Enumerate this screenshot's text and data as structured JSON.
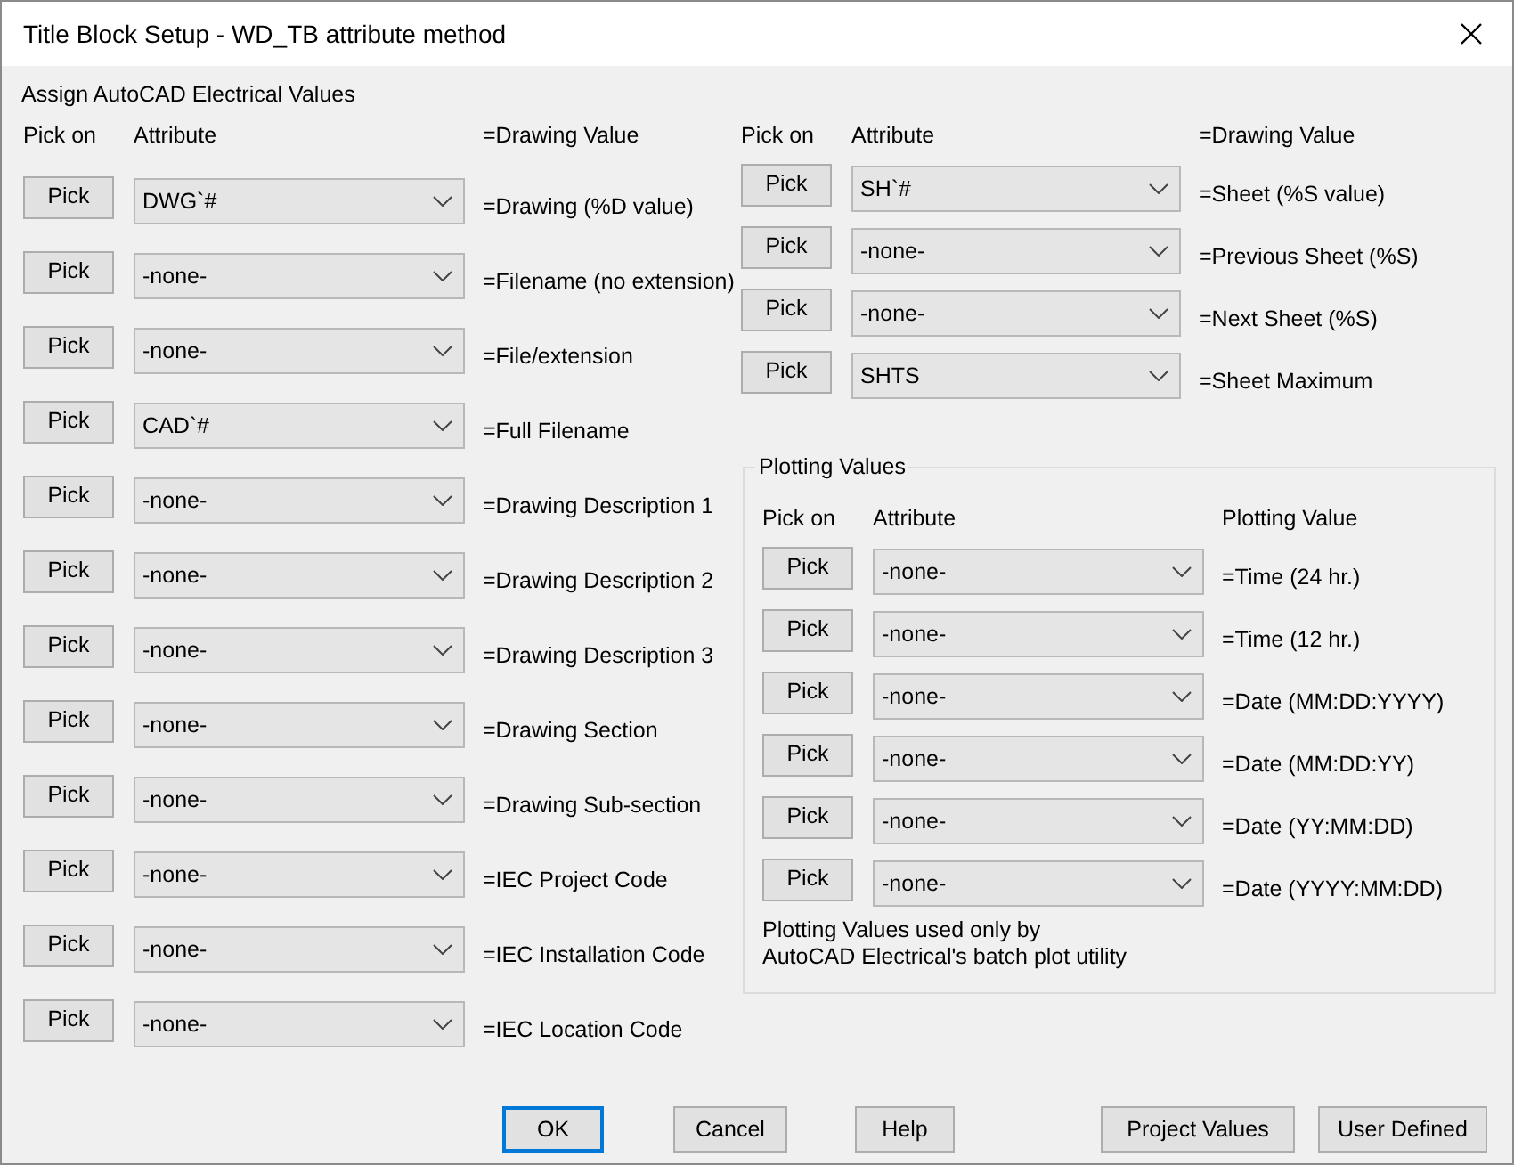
{
  "window": {
    "title": "Title Block Setup - WD_TB attribute method"
  },
  "section_label": "Assign AutoCAD Electrical Values",
  "left": {
    "headers": [
      "Pick on",
      "Attribute",
      "=Drawing Value"
    ],
    "rows": [
      {
        "button": "Pick",
        "attribute": "DWG`#",
        "label": "=Drawing (%D value)"
      },
      {
        "button": "Pick",
        "attribute": "-none-",
        "label": "=Filename (no extension)"
      },
      {
        "button": "Pick",
        "attribute": "-none-",
        "label": "=File/extension"
      },
      {
        "button": "Pick",
        "attribute": "CAD`#",
        "label": "=Full Filename"
      },
      {
        "button": "Pick",
        "attribute": "-none-",
        "label": "=Drawing Description 1"
      },
      {
        "button": "Pick",
        "attribute": "-none-",
        "label": "=Drawing Description 2"
      },
      {
        "button": "Pick",
        "attribute": "-none-",
        "label": "=Drawing Description 3"
      },
      {
        "button": "Pick",
        "attribute": "-none-",
        "label": "=Drawing Section"
      },
      {
        "button": "Pick",
        "attribute": "-none-",
        "label": "=Drawing Sub-section"
      },
      {
        "button": "Pick",
        "attribute": "-none-",
        "label": "=IEC Project Code"
      },
      {
        "button": "Pick",
        "attribute": "-none-",
        "label": "=IEC Installation Code"
      },
      {
        "button": "Pick",
        "attribute": "-none-",
        "label": "=IEC Location Code"
      }
    ]
  },
  "right": {
    "headers": [
      "Pick on",
      "Attribute",
      "=Drawing Value"
    ],
    "rows": [
      {
        "button": "Pick",
        "attribute": "SH`#",
        "label": "=Sheet (%S value)"
      },
      {
        "button": "Pick",
        "attribute": "-none-",
        "label": "=Previous Sheet (%S)"
      },
      {
        "button": "Pick",
        "attribute": "-none-",
        "label": "=Next Sheet (%S)"
      },
      {
        "button": "Pick",
        "attribute": "SHTS",
        "label": "=Sheet Maximum"
      }
    ]
  },
  "plotting": {
    "title": "Plotting Values",
    "headers": [
      "Pick on",
      "Attribute",
      "Plotting Value"
    ],
    "rows": [
      {
        "button": "Pick",
        "attribute": "-none-",
        "label": "=Time (24 hr.)"
      },
      {
        "button": "Pick",
        "attribute": "-none-",
        "label": "=Time (12 hr.)"
      },
      {
        "button": "Pick",
        "attribute": "-none-",
        "label": "=Date (MM:DD:YYYY)"
      },
      {
        "button": "Pick",
        "attribute": "-none-",
        "label": "=Date (MM:DD:YY)"
      },
      {
        "button": "Pick",
        "attribute": "-none-",
        "label": "=Date (YY:MM:DD)"
      },
      {
        "button": "Pick",
        "attribute": "-none-",
        "label": "=Date (YYYY:MM:DD)"
      }
    ],
    "note": [
      "Plotting Values used only by",
      "AutoCAD Electrical's batch plot utility"
    ]
  },
  "buttons": [
    {
      "label": "OK",
      "focused": true
    },
    {
      "label": "Cancel",
      "focused": false
    },
    {
      "label": "Help",
      "focused": false
    },
    {
      "label": "Project Values",
      "focused": false
    },
    {
      "label": "User Defined",
      "focused": false
    }
  ]
}
